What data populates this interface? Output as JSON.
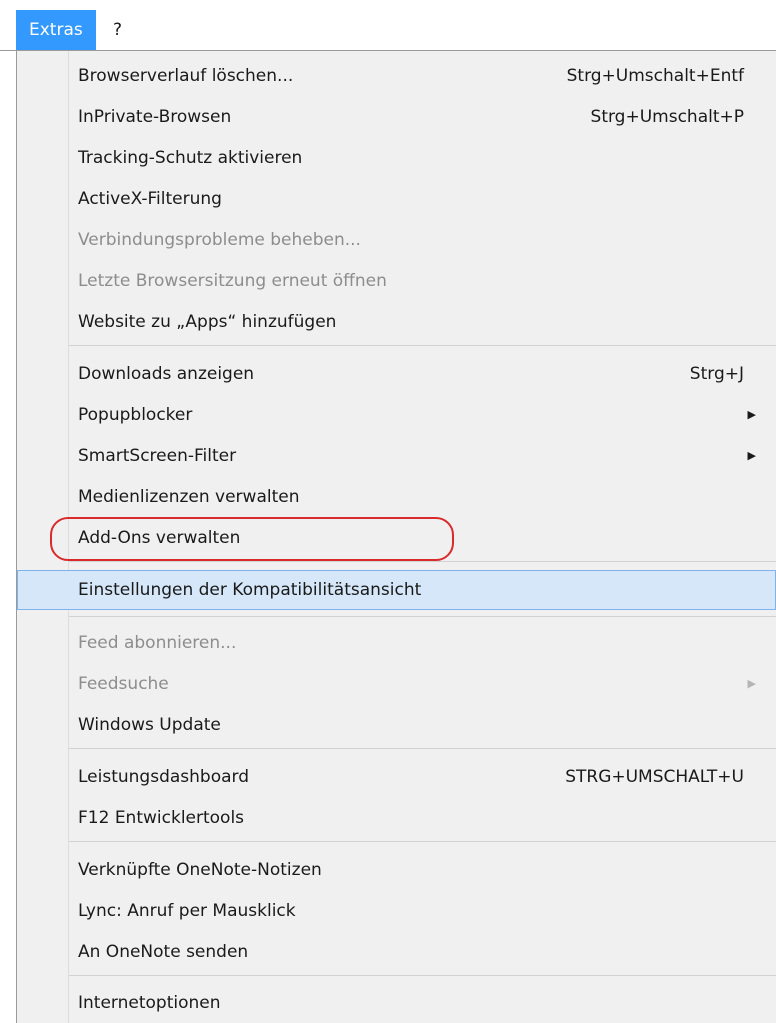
{
  "menubar": {
    "extras": "Extras",
    "help": "?"
  },
  "menu": {
    "items": [
      {
        "label": "Browserverlauf löschen...",
        "shortcut": "Strg+Umschalt+Entf"
      },
      {
        "label": "InPrivate-Browsen",
        "shortcut": "Strg+Umschalt+P"
      },
      {
        "label": "Tracking-Schutz aktivieren"
      },
      {
        "label": "ActiveX-Filterung"
      },
      {
        "label": "Verbindungsprobleme beheben..."
      },
      {
        "label": "Letzte Browsersitzung erneut öffnen"
      },
      {
        "label": "Website zu „Apps“ hinzufügen"
      },
      {
        "label": "Downloads anzeigen",
        "shortcut": "Strg+J"
      },
      {
        "label": "Popupblocker",
        "submenu_arrow": "▶"
      },
      {
        "label": "SmartScreen-Filter",
        "submenu_arrow": "▶"
      },
      {
        "label": "Medienlizenzen verwalten"
      },
      {
        "label": "Add-Ons verwalten"
      },
      {
        "label": "Einstellungen der Kompatibilitätsansicht"
      },
      {
        "label": "Feed abonnieren..."
      },
      {
        "label": "Feedsuche",
        "submenu_arrow": "▶"
      },
      {
        "label": "Windows Update"
      },
      {
        "label": "Leistungsdashboard",
        "shortcut": "STRG+UMSCHALT+U"
      },
      {
        "label": "F12 Entwicklertools"
      },
      {
        "label": "Verknüpfte OneNote-Notizen"
      },
      {
        "label": "Lync: Anruf per Mausklick"
      },
      {
        "label": "An OneNote senden"
      },
      {
        "label": "Internetoptionen"
      }
    ]
  },
  "colors": {
    "menubar_active_bg": "#3399ff",
    "highlight_bg": "#d5e7f8",
    "highlight_border": "#7eb4ea",
    "callout": "#d92b2b",
    "disabled_text": "#8d8d8d"
  }
}
